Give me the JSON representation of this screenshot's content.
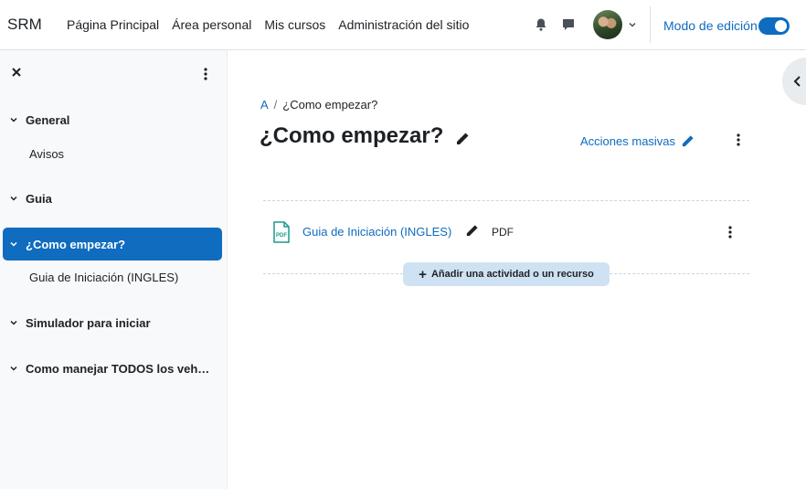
{
  "navbar": {
    "brand": "SRM",
    "links": [
      "Página Principal",
      "Área personal",
      "Mis cursos",
      "Administración del sitio"
    ],
    "edit_mode_label": "Modo de edición",
    "edit_mode_on": true
  },
  "drawer": {
    "sections": [
      {
        "label": "General",
        "children": [
          "Avisos"
        ]
      },
      {
        "label": "Guia",
        "children": []
      },
      {
        "label": "¿Como empezar?",
        "active": true,
        "children": [
          "Guia de Iniciación (INGLES)"
        ]
      },
      {
        "label": "Simulador para iniciar",
        "children": []
      },
      {
        "label": "Como manejar TODOS los veh…",
        "children": []
      }
    ]
  },
  "main": {
    "breadcrumb": [
      "A",
      "¿Como empezar?"
    ],
    "breadcrumb_sep": "/",
    "title": "¿Como empezar?",
    "bulk_actions": "Acciones masivas",
    "activity": {
      "name": "Guia de Iniciación (INGLES)",
      "type": "PDF",
      "icon_label": "PDF"
    },
    "add_button": "Añadir una actividad o un recurso"
  },
  "colors": {
    "accent": "#0f6cbf",
    "drawer_bg": "#f8f9fa",
    "add_bg": "#cfe2f3"
  }
}
